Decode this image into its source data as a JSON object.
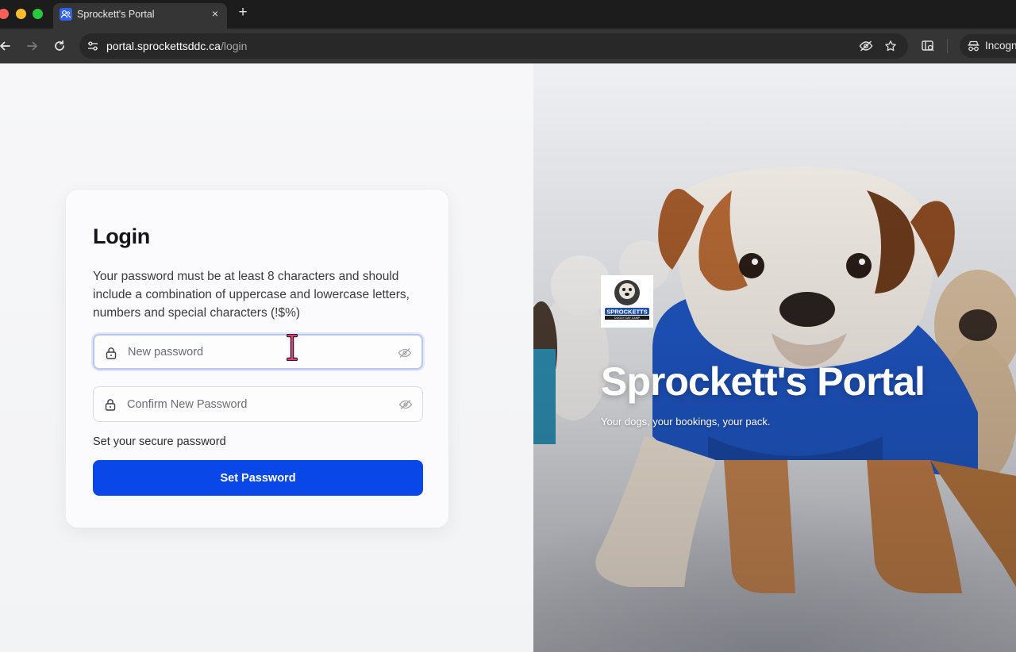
{
  "browser": {
    "tab_title": "Sprockett's Portal",
    "tab_close": "×",
    "new_tab": "+",
    "url_host": "portal.sprockettsddc.ca",
    "url_path": "/login",
    "incognito_label": "Incognito"
  },
  "login": {
    "title": "Login",
    "description": "Your password must be at least 8 characters and should include a combination of uppercase and lowercase letters, numbers and special characters (!$%)",
    "new_password_placeholder": "New password",
    "confirm_password_placeholder": "Confirm New Password",
    "helper_text": "Set your secure password",
    "submit_label": "Set Password"
  },
  "hero": {
    "title": "Sprockett's Portal",
    "subtitle": "Your dogs, your bookings, your pack.",
    "logo_text": "SPROCKETTS",
    "logo_subtext": "DOGGY DAY CAMP"
  },
  "colors": {
    "primary": "#0a47e8",
    "tab_favicon": "#2f62e8",
    "dog_shirt": "#1f57c6"
  }
}
